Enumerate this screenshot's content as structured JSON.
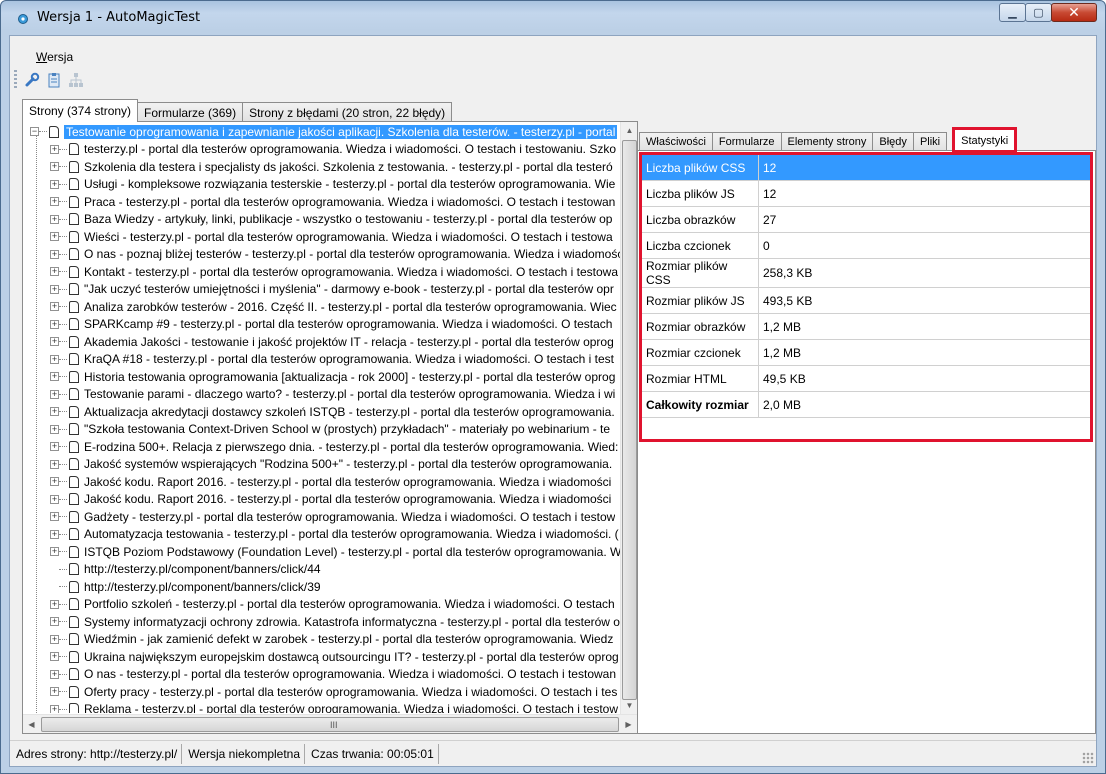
{
  "window": {
    "title": "Wersja 1 - AutoMagicTest",
    "controls": [
      "minimize",
      "maximize",
      "close"
    ]
  },
  "menu": {
    "wersja_prefix": "W",
    "wersja_rest": "ersja"
  },
  "toolbar": {
    "icons": [
      "wrench-icon",
      "clipboard-icon",
      "sitemap-icon"
    ]
  },
  "left_tabs": [
    "Strony (374 strony)",
    "Formularze (369)",
    "Strony z błędami (20 stron, 22 błędy)"
  ],
  "tree": {
    "root": "Testowanie oprogramowania i zapewnianie jakości aplikacji. Szkolenia dla testerów. - testerzy.pl - portal",
    "items": [
      {
        "label": "testerzy.pl - portal dla testerów oprogramowania. Wiedza i wiadomości. O testach i testowaniu. Szko",
        "expandable": true
      },
      {
        "label": "Szkolenia dla testera i specjalisty ds jakości. Szkolenia z testowania. - testerzy.pl - portal dla testeró",
        "expandable": true
      },
      {
        "label": "Usługi - kompleksowe rozwiązania testerskie - testerzy.pl - portal dla testerów oprogramowania. Wie",
        "expandable": true
      },
      {
        "label": "Praca - testerzy.pl - portal dla testerów oprogramowania. Wiedza i wiadomości. O testach i testowan",
        "expandable": true
      },
      {
        "label": "Baza Wiedzy - artykuły, linki, publikacje - wszystko o testowaniu - testerzy.pl - portal dla testerów op",
        "expandable": true
      },
      {
        "label": "Wieści - testerzy.pl - portal dla testerów oprogramowania. Wiedza i wiadomości. O testach i testowa",
        "expandable": true
      },
      {
        "label": "O nas - poznaj bliżej testerów - testerzy.pl - portal dla testerów oprogramowania. Wiedza i wiadomość",
        "expandable": true
      },
      {
        "label": "Kontakt - testerzy.pl - portal dla testerów oprogramowania. Wiedza i wiadomości. O testach i testowa",
        "expandable": true
      },
      {
        "label": "\"Jak uczyć testerów umiejętności i myślenia\" - darmowy e-book - testerzy.pl - portal dla testerów opr",
        "expandable": true
      },
      {
        "label": "Analiza zarobków testerów - 2016. Część II. - testerzy.pl - portal dla testerów oprogramowania. Wiec",
        "expandable": true
      },
      {
        "label": "SPARKcamp #9 - testerzy.pl - portal dla testerów oprogramowania. Wiedza i wiadomości. O testach",
        "expandable": true
      },
      {
        "label": "Akademia Jakości - testowanie i jakość projektów IT - relacja - testerzy.pl - portal dla testerów oprog",
        "expandable": true
      },
      {
        "label": "KraQA #18 - testerzy.pl - portal dla testerów oprogramowania. Wiedza i wiadomości. O testach i test",
        "expandable": true
      },
      {
        "label": "Historia testowania oprogramowania [aktualizacja - rok 2000] - testerzy.pl - portal dla testerów oprog",
        "expandable": true
      },
      {
        "label": "Testowanie parami - dlaczego warto? - testerzy.pl - portal dla testerów oprogramowania. Wiedza i wi",
        "expandable": true
      },
      {
        "label": "Aktualizacja akredytacji dostawcy szkoleń ISTQB - testerzy.pl - portal dla testerów oprogramowania.",
        "expandable": true
      },
      {
        "label": "\"Szkoła testowania Context-Driven School w (prostych) przykładach\" - materiały po webinarium - te",
        "expandable": true
      },
      {
        "label": "E-rodzina 500+. Relacja z pierwszego dnia. - testerzy.pl - portal dla testerów oprogramowania. Wied:",
        "expandable": true
      },
      {
        "label": "Jakość systemów wspierających \"Rodzina 500+\" - testerzy.pl - portal dla testerów oprogramowania.",
        "expandable": true
      },
      {
        "label": "Jakość kodu. Raport 2016. - testerzy.pl - portal dla testerów oprogramowania. Wiedza i wiadomości",
        "expandable": true
      },
      {
        "label": "Jakość kodu. Raport 2016. - testerzy.pl - portal dla testerów oprogramowania. Wiedza i wiadomości",
        "expandable": true
      },
      {
        "label": "Gadżety - testerzy.pl - portal dla testerów oprogramowania. Wiedza i wiadomości. O testach i testow",
        "expandable": true
      },
      {
        "label": "Automatyzacja testowania - testerzy.pl - portal dla testerów oprogramowania. Wiedza i wiadomości. (",
        "expandable": true
      },
      {
        "label": "ISTQB Poziom Podstawowy (Foundation Level) - testerzy.pl - portal dla testerów oprogramowania. W",
        "expandable": true
      },
      {
        "label": "http://testerzy.pl/component/banners/click/44",
        "expandable": false
      },
      {
        "label": "http://testerzy.pl/component/banners/click/39",
        "expandable": false
      },
      {
        "label": "Portfolio szkoleń - testerzy.pl - portal dla testerów oprogramowania. Wiedza i wiadomości. O testach",
        "expandable": true
      },
      {
        "label": "Systemy informatyzacji ochrony zdrowia. Katastrofa informatyczna - testerzy.pl - portal dla testerów o",
        "expandable": true
      },
      {
        "label": "Wiedźmin - jak zamienić defekt w zarobek - testerzy.pl - portal dla testerów oprogramowania. Wiedz",
        "expandable": true
      },
      {
        "label": "Ukraina największym europejskim dostawcą outsourcingu IT? - testerzy.pl - portal dla testerów oprog",
        "expandable": true
      },
      {
        "label": "O nas - testerzy.pl - portal dla testerów oprogramowania. Wiedza i wiadomości. O testach i testowan",
        "expandable": true
      },
      {
        "label": "Oferty pracy - testerzy.pl - portal dla testerów oprogramowania. Wiedza i wiadomości. O testach i tes",
        "expandable": true
      },
      {
        "label": "Reklama - testerzy.pl - portal dla testerów oprogramowania. Wiedza i wiadomości. O testach i testow",
        "expandable": true
      }
    ]
  },
  "hscroll": {
    "grip": "III"
  },
  "right_tabs": [
    "Właściwości",
    "Formularze",
    "Elementy strony",
    "Błędy",
    "Pliki",
    "Statystyki"
  ],
  "stats": [
    {
      "key": "Liczba plików CSS",
      "value": "12"
    },
    {
      "key": "Liczba plików JS",
      "value": "12"
    },
    {
      "key": "Liczba obrazków",
      "value": "27"
    },
    {
      "key": "Liczba czcionek",
      "value": "0"
    },
    {
      "key": "Rozmiar plików CSS",
      "value": "258,3 KB"
    },
    {
      "key": "Rozmiar plików JS",
      "value": "493,5 KB"
    },
    {
      "key": "Rozmiar obrazków",
      "value": "1,2 MB"
    },
    {
      "key": "Rozmiar czcionek",
      "value": "1,2 MB"
    },
    {
      "key": "Rozmiar HTML",
      "value": "49,5 KB"
    },
    {
      "key": "Całkowity rozmiar",
      "value": "2,0 MB"
    }
  ],
  "statusbar": {
    "address": "Adres strony: http://testerzy.pl/",
    "version": "Wersja niekompletna",
    "duration": "Czas trwania: 00:05:01"
  }
}
